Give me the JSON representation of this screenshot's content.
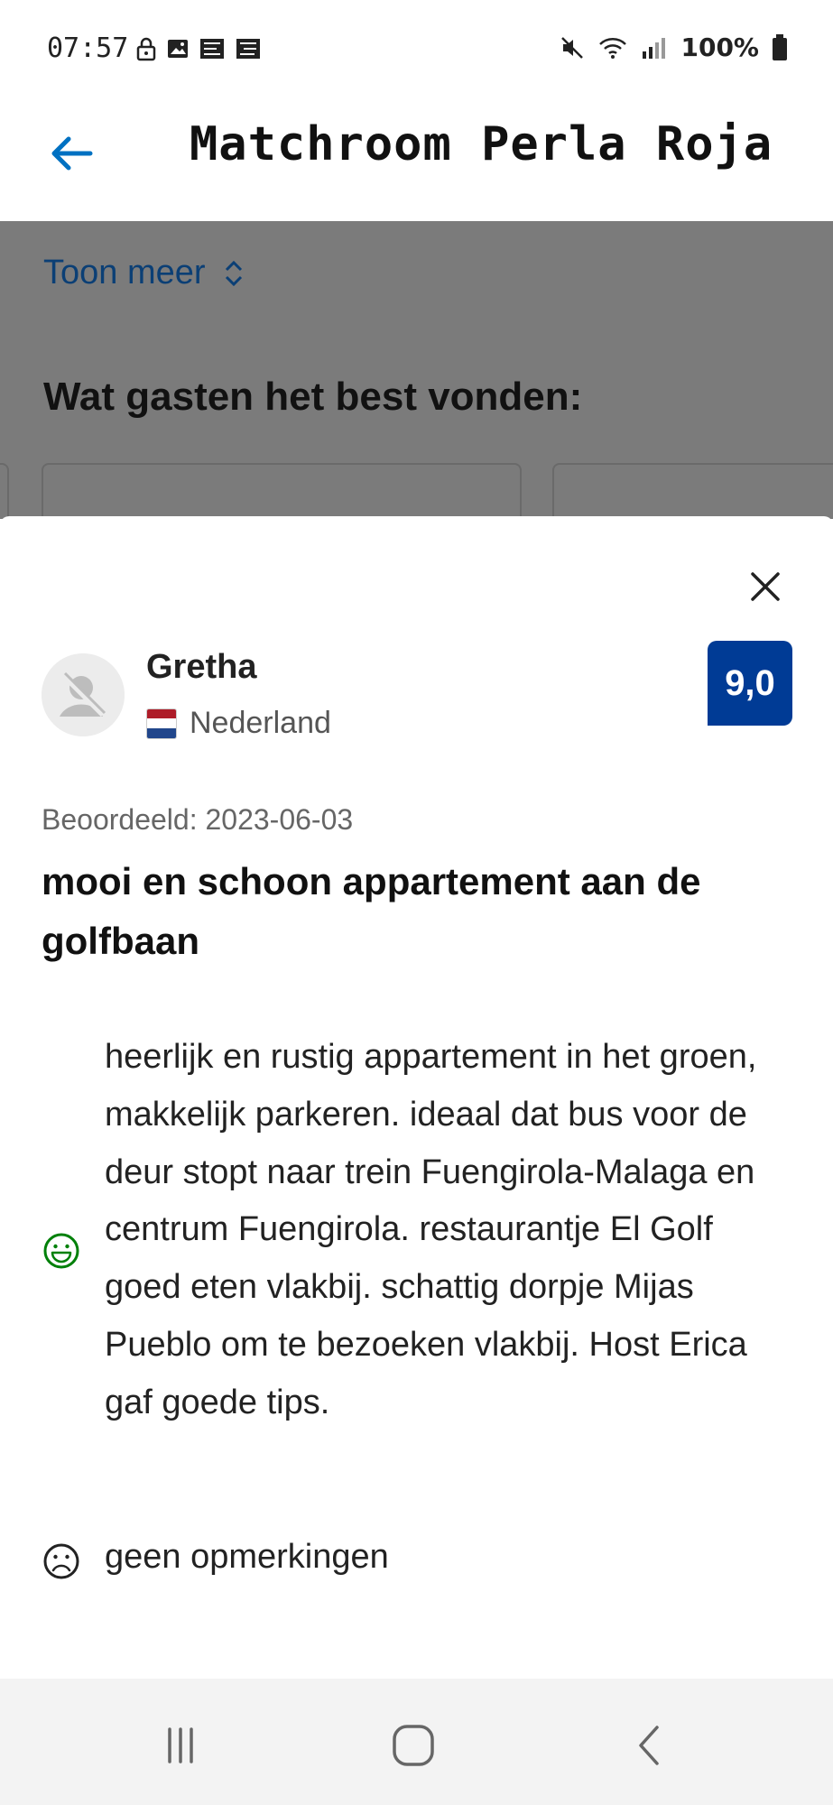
{
  "status_bar": {
    "time": "07:57",
    "battery": "100%"
  },
  "header": {
    "title": "Matchroom Perla Roja"
  },
  "background": {
    "toon_meer": "Toon meer",
    "heading": "Wat gasten het best vonden:"
  },
  "review": {
    "reviewer_name": "Gretha",
    "country": "Nederland",
    "score": "9,0",
    "date_label": "Beoordeeld: 2023-06-03",
    "title": "mooi en schoon appartement aan de golfbaan",
    "positive": "heerlijk en rustig appartement in het groen, makkelijk parkeren. ideaal dat bus voor de deur stopt naar trein Fuengirola-Malaga en centrum Fuengirola. restaurantje El Golf goed eten vlakbij. schattig dorpje Mijas Pueblo om te bezoeken vlakbij. Host Erica gaf goede tips.",
    "negative": "geen opmerkingen"
  },
  "icons": {
    "back": "arrow-left-icon",
    "close": "close-icon",
    "positive": "smiley-happy-icon",
    "negative": "smiley-sad-icon",
    "chevron": "chevron-up-down-icon"
  },
  "colors": {
    "accent": "#0071c2",
    "score_badge": "#003b95",
    "positive_icon": "#008009",
    "scrim_text": "#0b3f75"
  }
}
